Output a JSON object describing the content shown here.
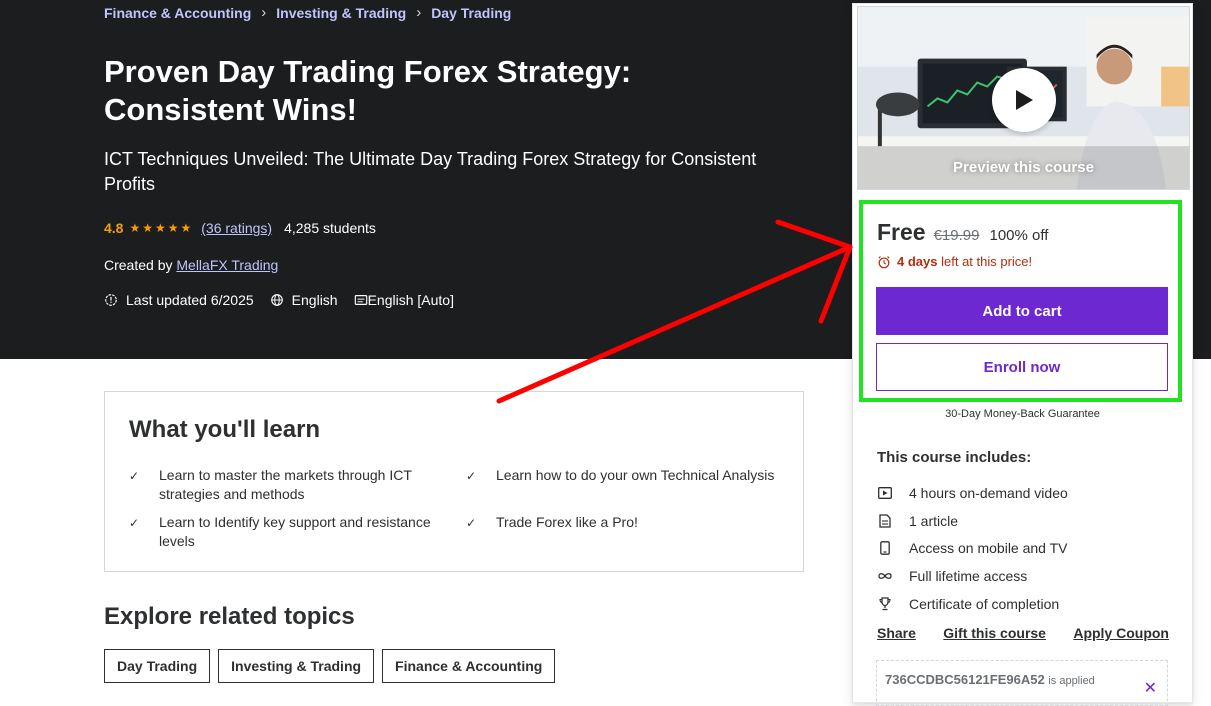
{
  "breadcrumb": [
    {
      "label": "Finance & Accounting"
    },
    {
      "label": "Investing & Trading"
    },
    {
      "label": "Day Trading"
    }
  ],
  "course": {
    "title": "Proven Day Trading Forex Strategy: Consistent Wins!",
    "subtitle": "ICT Techniques Unveiled: The Ultimate Day Trading Forex Strategy for Consistent Profits",
    "rating": "4.8",
    "stars": "★★★★★",
    "ratings_count": "(36 ratings)",
    "students": "4,285 students",
    "created_by_label": "Created by",
    "instructor": "MellaFX Trading",
    "last_updated": "Last updated 6/2025",
    "language": "English",
    "captions": "English [Auto]"
  },
  "learn": {
    "title": "What you'll learn",
    "items": [
      "Learn to master the markets through ICT strategies and methods",
      "Learn how to do your own Technical Analysis",
      "Learn to Identify key support and resistance levels",
      "Trade Forex like a Pro!"
    ]
  },
  "explore": {
    "title": "Explore related topics",
    "topics": [
      "Day Trading",
      "Investing & Trading",
      "Finance & Accounting"
    ]
  },
  "sidebar": {
    "preview_label": "Preview this course",
    "price": "Free",
    "original_price": "€19.99",
    "discount": "100% off",
    "timer_bold": "4 days",
    "timer_rest": "left at this price!",
    "add_to_cart": "Add to cart",
    "enroll_now": "Enroll now",
    "guarantee": "30-Day Money-Back Guarantee",
    "includes_title": "This course includes:",
    "includes": [
      {
        "icon": "video-icon",
        "label": "4 hours on-demand video"
      },
      {
        "icon": "article-icon",
        "label": "1 article"
      },
      {
        "icon": "mobile-icon",
        "label": "Access on mobile and TV"
      },
      {
        "icon": "infinity-icon",
        "label": "Full lifetime access"
      },
      {
        "icon": "trophy-icon",
        "label": "Certificate of completion"
      }
    ],
    "share": "Share",
    "gift": "Gift this course",
    "apply_coupon": "Apply Coupon",
    "coupon_code": "736CCDBC56121FE96A52",
    "coupon_status": "is applied"
  },
  "colors": {
    "hero_bg": "#1c1d1f",
    "accent_purple": "#6d28d2",
    "link_lavender": "#c0c4fc",
    "rating_orange": "#f69c08",
    "timer_red": "#b32d0f",
    "annotation_green": "#22e322",
    "annotation_red": "#ff0000"
  }
}
